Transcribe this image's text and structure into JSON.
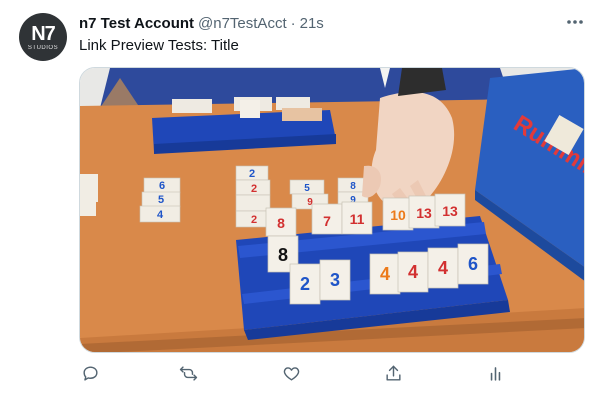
{
  "account": {
    "avatar_mark": "N7",
    "avatar_sub": "STUDIOS",
    "display_name": "n7 Test Account",
    "handle": "@n7TestAcct",
    "separator": "·",
    "time": "21s"
  },
  "tweet": {
    "text": "Link Preview Tests: Title"
  },
  "media": {
    "subject": "rummikub-game-photo",
    "box_brand": "Rummikub",
    "tiles": {
      "back_rack": [],
      "left_column": [
        "6",
        "5",
        "4"
      ],
      "middle_column": [
        "2",
        "2",
        "2"
      ],
      "center_cluster": [
        "5",
        "9",
        "8",
        "9"
      ],
      "rack_top": [
        "8",
        "7",
        "11",
        "10",
        "13",
        "13"
      ],
      "rack_bottom": [
        "8",
        "2",
        "3",
        "4",
        "4",
        "4",
        "6"
      ]
    }
  },
  "actions": {
    "reply_icon": "reply-icon",
    "retweet_icon": "retweet-icon",
    "like_icon": "like-icon",
    "share_icon": "share-icon",
    "analytics_icon": "analytics-icon"
  },
  "colors": {
    "text_primary": "#0f1419",
    "text_secondary": "#536471",
    "border": "#cfd9de",
    "rack_blue": "#1f47b8",
    "table_wood": "#d9894a"
  }
}
